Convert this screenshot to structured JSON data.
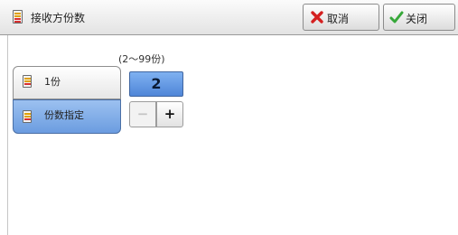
{
  "window": {
    "title": "接收方份数"
  },
  "toolbar": {
    "cancel_label": "取消",
    "close_label": "关闭"
  },
  "options": [
    {
      "label": "1份",
      "selected": false
    },
    {
      "label": "份数指定",
      "selected": true
    }
  ],
  "copies": {
    "range_label": "(2～99份)",
    "value": "2",
    "minus_label": "−",
    "plus_label": "+"
  },
  "colors": {
    "selected_blue": "#6b9ce0",
    "cancel_icon_red": "#d42020",
    "close_icon_green": "#37a83a"
  }
}
